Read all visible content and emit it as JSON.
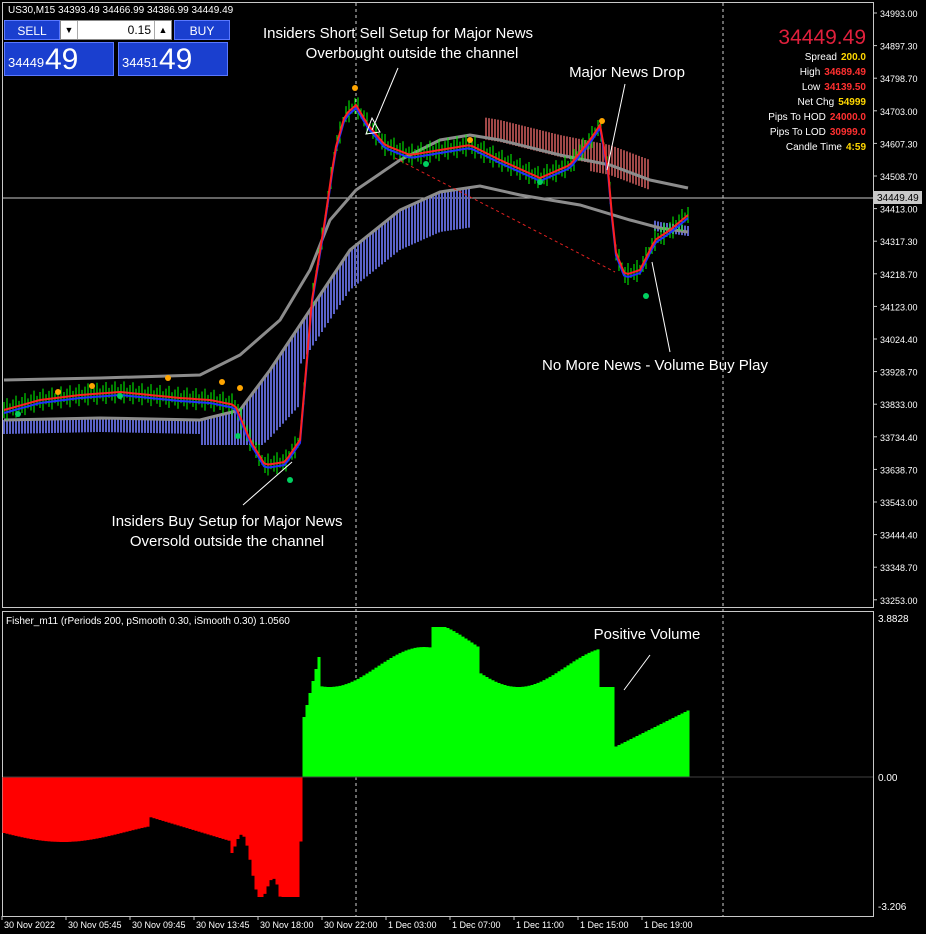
{
  "symbol_header": "US30,M15  34393.49 34466.99 34386.99 34449.49",
  "trade_panel": {
    "sell_label": "SELL",
    "buy_label": "BUY",
    "lot": "0.15",
    "bid_small": "34449",
    "bid_big": "49",
    "ask_small": "34451",
    "ask_big": "49"
  },
  "info_panel": {
    "price": "34449.49",
    "rows": [
      {
        "label": "Spread",
        "value": "200.0",
        "color": "#ffd700"
      },
      {
        "label": "High",
        "value": "34689.49",
        "color": "#ff3030"
      },
      {
        "label": "Low",
        "value": "34139.50",
        "color": "#ff3030"
      },
      {
        "label": "Net Chg",
        "value": "54999",
        "color": "#ffd700"
      },
      {
        "label": "Pips To HOD",
        "value": "24000.0",
        "color": "#ff3030"
      },
      {
        "label": "Pips To LOD",
        "value": "30999.0",
        "color": "#ff3030"
      },
      {
        "label": "Candle Time",
        "value": "4:59",
        "color": "#ffd700"
      }
    ]
  },
  "annotations": {
    "short_sell_1": "Insiders Short Sell Setup for Major News",
    "short_sell_2": "Overbought outside the channel",
    "news_drop": "Major News Drop",
    "volume_buy": "No More News - Volume Buy Play",
    "buy_setup_1": "Insiders Buy Setup for Major News",
    "buy_setup_2": "Oversold outside the channel",
    "positive_volume": "Positive Volume"
  },
  "price_axis": [
    "34993.00",
    "34897.30",
    "34798.70",
    "34703.00",
    "34607.30",
    "34508.70",
    "34413.00",
    "34317.30",
    "34218.70",
    "34123.00",
    "34024.40",
    "33928.70",
    "33833.00",
    "33734.40",
    "33638.70",
    "33543.00",
    "33444.40",
    "33348.70",
    "33253.00"
  ],
  "current_price_label": "34449.49",
  "indicator": {
    "label": "Fisher_m11  (rPeriods 200, pSmooth 0.30, iSmooth 0.30)   1.0560",
    "axis": [
      "3.8828",
      "0.00",
      "-3.206"
    ]
  },
  "time_axis": [
    "30 Nov 2022",
    "30 Nov 05:45",
    "30 Nov 09:45",
    "30 Nov 13:45",
    "30 Nov 18:00",
    "30 Nov 22:00",
    "1 Dec 03:00",
    "1 Dec 07:00",
    "1 Dec 11:00",
    "1 Dec 15:00",
    "1 Dec 19:00"
  ],
  "colors": {
    "positive_histogram": "#00ff00",
    "negative_histogram": "#ff0000",
    "candle": "#00ff00",
    "channel": "#8c8c8c",
    "cloud_up": "#5a62c8",
    "cloud_down": "#a04848"
  }
}
